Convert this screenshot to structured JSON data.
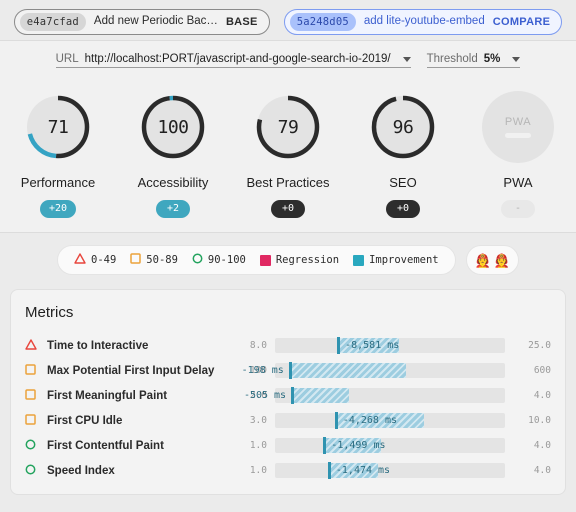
{
  "header": {
    "base": {
      "hash": "e4a7cfad",
      "message": "Add new Periodic Bac…",
      "tag": "BASE"
    },
    "compare": {
      "hash": "5a248d05",
      "message": "add lite-youtube-embed",
      "tag": "COMPARE"
    }
  },
  "controls": {
    "url_label": "URL",
    "url_value": "http://localhost:PORT/javascript-and-google-search-io-2019/",
    "threshold_label": "Threshold",
    "threshold_value": "5%"
  },
  "gauges": [
    {
      "name": "Performance",
      "score": "71",
      "delta": "+20",
      "delta_style": "teal",
      "arc_pct": 71,
      "delta_pct": 20,
      "icon": "gauge-ring"
    },
    {
      "name": "Accessibility",
      "score": "100",
      "delta": "+2",
      "delta_style": "teal",
      "arc_pct": 100,
      "delta_pct": 2,
      "icon": "gauge-ring"
    },
    {
      "name": "Best Practices",
      "score": "79",
      "delta": "+0",
      "delta_style": "dark",
      "arc_pct": 79,
      "delta_pct": 0,
      "icon": "gauge-ring"
    },
    {
      "name": "SEO",
      "score": "96",
      "delta": "+0",
      "delta_style": "dark",
      "arc_pct": 96,
      "delta_pct": 0,
      "icon": "gauge-ring"
    },
    {
      "name": "PWA",
      "score": "PWA",
      "delta": "-",
      "delta_style": "none",
      "arc_pct": 0,
      "delta_pct": 0,
      "icon": "pwa-disk"
    }
  ],
  "legend": {
    "items": [
      {
        "label": "0-49",
        "icon": "triangle-outline-icon",
        "color": "#e8453c"
      },
      {
        "label": "50-89",
        "icon": "square-outline-icon",
        "color": "#eba23b"
      },
      {
        "label": "90-100",
        "icon": "circle-outline-icon",
        "color": "#23a35e"
      },
      {
        "label": "Regression",
        "icon": "square-filled-icon",
        "color": "#e02862"
      },
      {
        "label": "Improvement",
        "icon": "square-filled-icon",
        "color": "#29a8bf"
      }
    ],
    "avatars": [
      "🧑‍🚒",
      "🧑‍🚒"
    ]
  },
  "metrics": {
    "title": "Metrics",
    "rows": [
      {
        "label": "Time to Interactive",
        "icon": "triangle-outline-icon",
        "icon_color": "#e8453c",
        "min": "8.0",
        "max": "25.0",
        "value": "-8,581 ms",
        "marker_pct": 27,
        "fill_pct": 54,
        "value_side": "right"
      },
      {
        "label": "Max Potential First Input Delay",
        "icon": "square-outline-icon",
        "icon_color": "#eba23b",
        "min": "100",
        "max": "600",
        "value": "-198 ms",
        "marker_pct": 6,
        "fill_pct": 57,
        "value_side": "left"
      },
      {
        "label": "First Meaningful Paint",
        "icon": "square-outline-icon",
        "icon_color": "#eba23b",
        "min": "2.0",
        "max": "4.0",
        "value": "-505 ms",
        "marker_pct": 7,
        "fill_pct": 32,
        "value_side": "left"
      },
      {
        "label": "First CPU Idle",
        "icon": "square-outline-icon",
        "icon_color": "#eba23b",
        "min": "3.0",
        "max": "10.0",
        "value": "-4,268 ms",
        "marker_pct": 26,
        "fill_pct": 65,
        "value_side": "right"
      },
      {
        "label": "First Contentful Paint",
        "icon": "circle-outline-icon",
        "icon_color": "#23a35e",
        "min": "1.0",
        "max": "4.0",
        "value": "-1,499 ms",
        "marker_pct": 21,
        "fill_pct": 46,
        "value_side": "right"
      },
      {
        "label": "Speed Index",
        "icon": "circle-outline-icon",
        "icon_color": "#23a35e",
        "min": "1.0",
        "max": "4.0",
        "value": "-1,474 ms",
        "marker_pct": 23,
        "fill_pct": 45,
        "value_side": "right"
      }
    ]
  }
}
